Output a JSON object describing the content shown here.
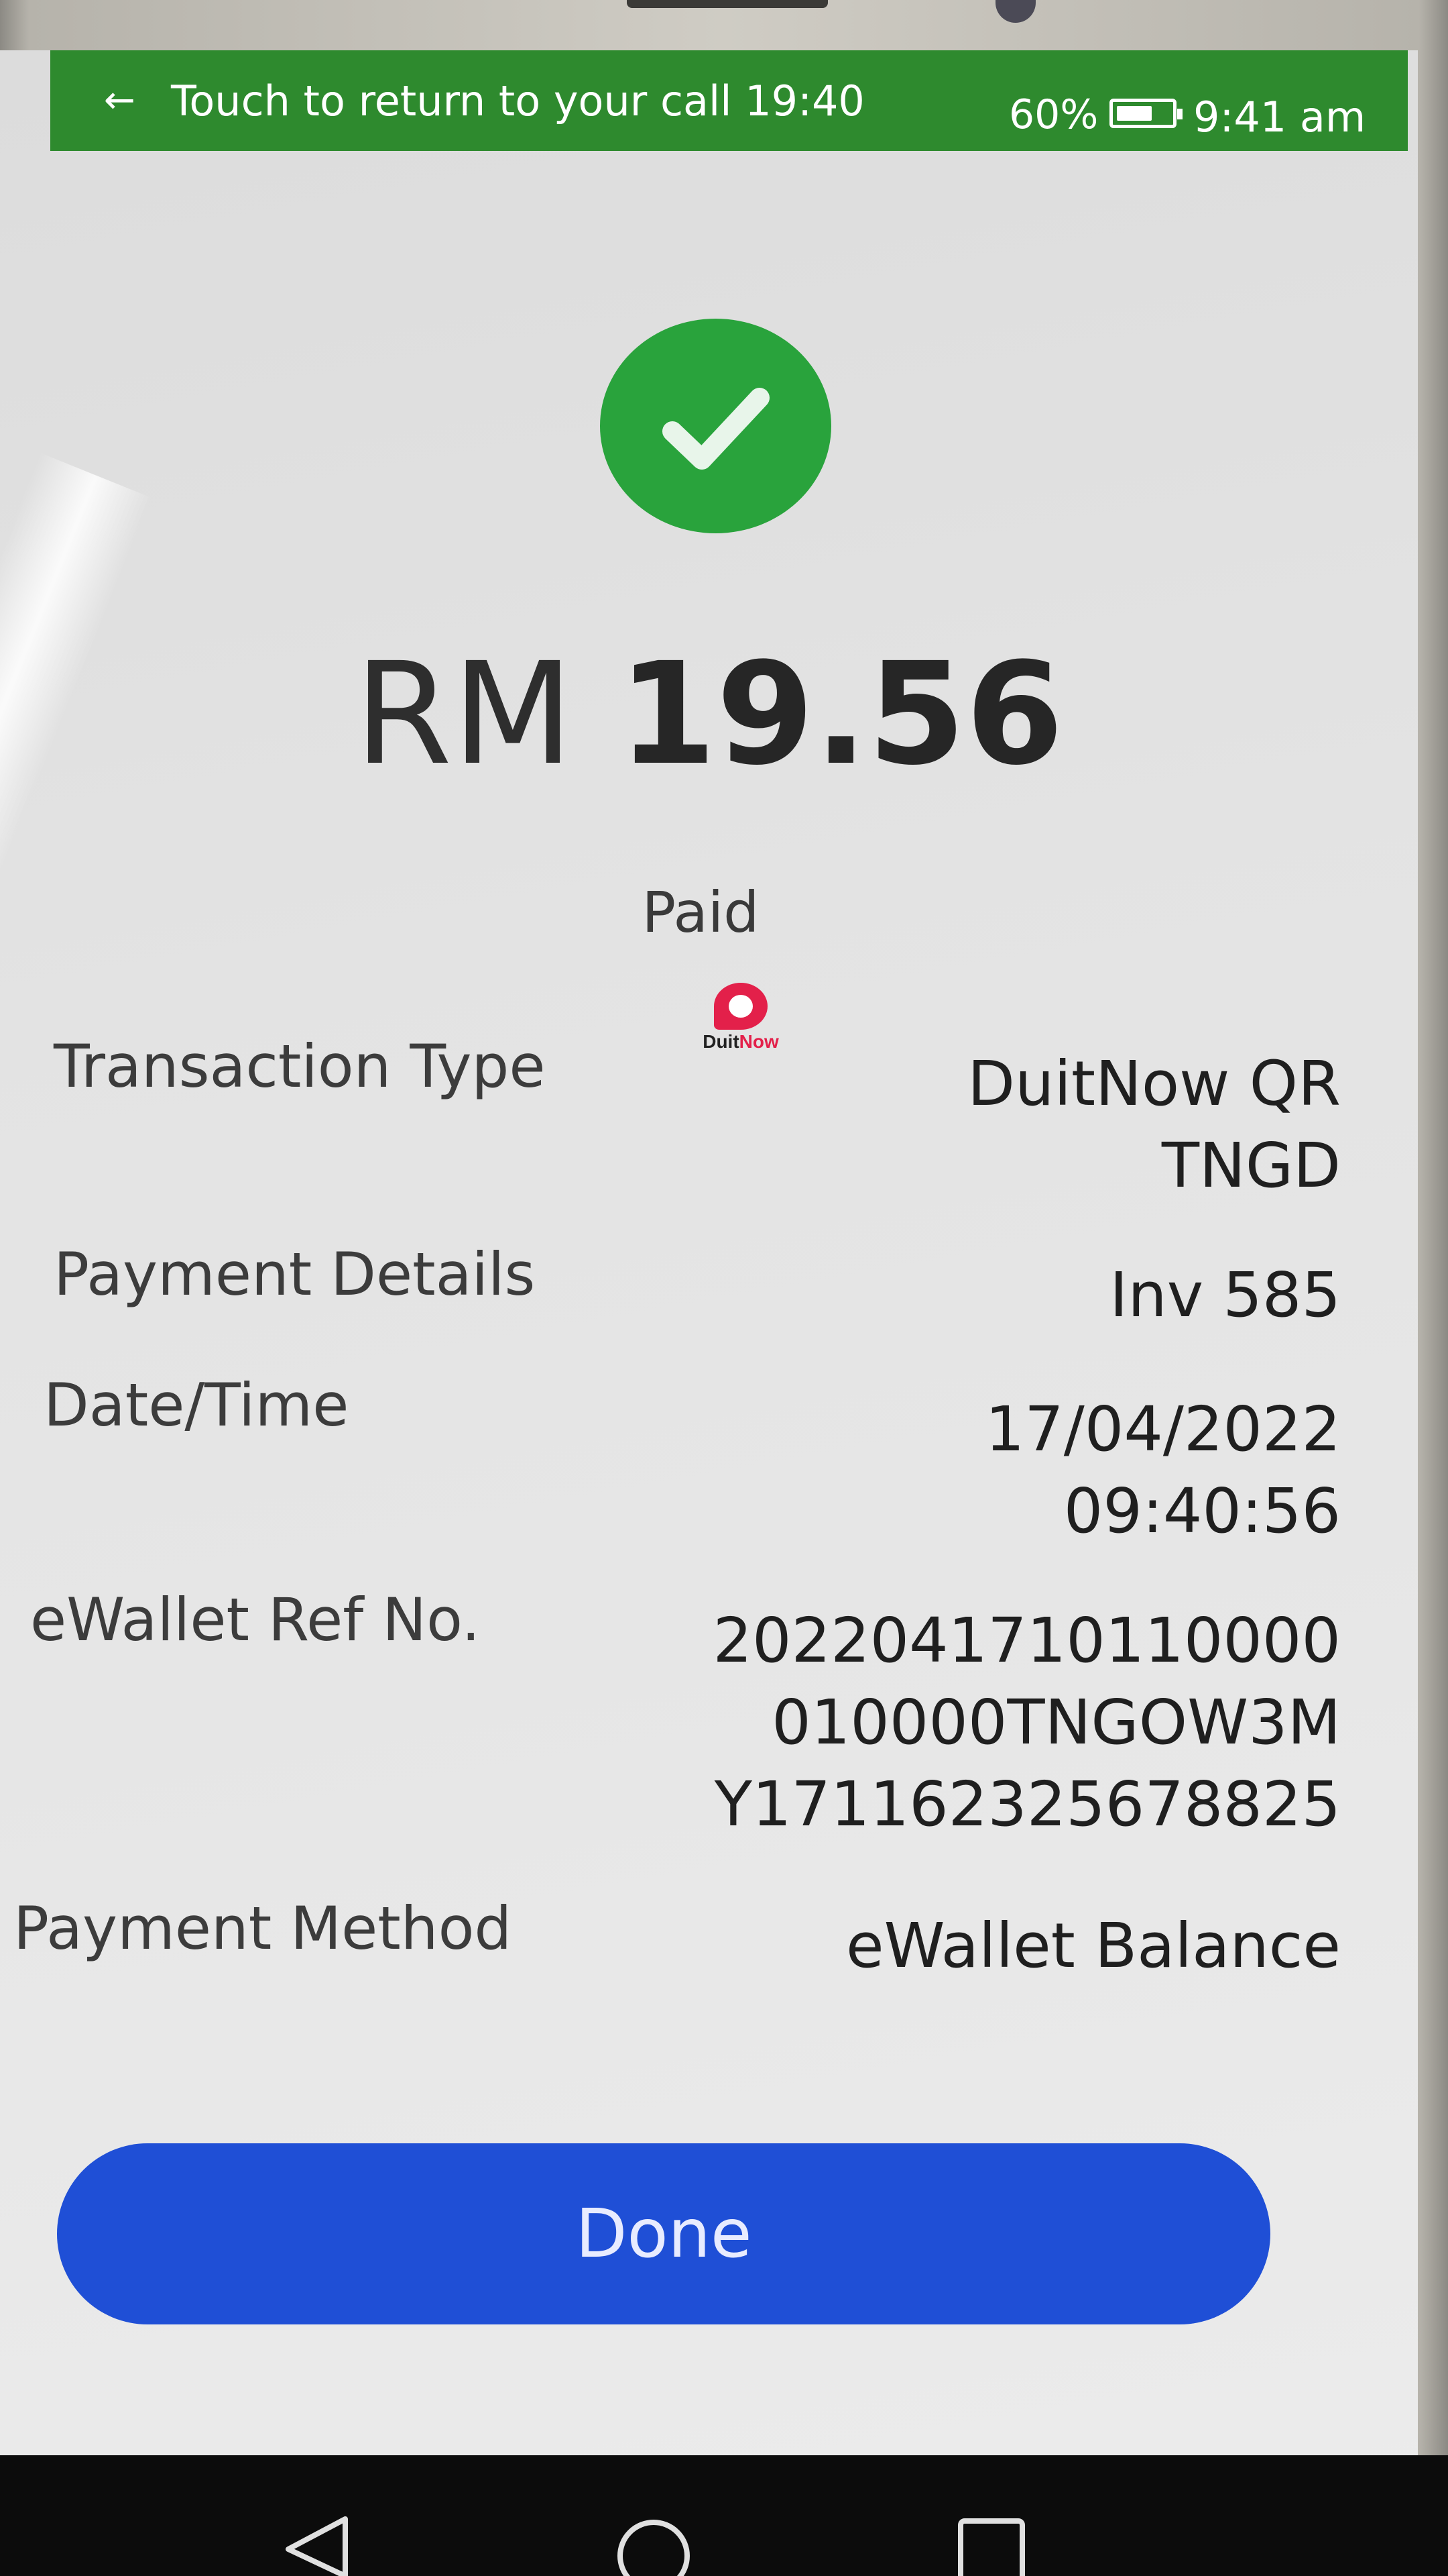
{
  "status_bar": {
    "call_text": "Touch to return to your call 19:40",
    "battery_percent": "60%",
    "clock": "9:41 am",
    "back_icon": "back-arrow-icon",
    "battery_icon": "battery-icon",
    "bar_color": "#2e8a2e"
  },
  "receipt": {
    "currency": "RM",
    "amount": "19.56",
    "status": "Paid",
    "success_color": "#29a33c",
    "rows": [
      {
        "label": "Transaction Type",
        "lines": [
          "DuitNow QR",
          "TNGD"
        ]
      },
      {
        "label": "Payment Details",
        "lines": [
          "Inv 585"
        ]
      },
      {
        "label": "Date/Time",
        "lines": [
          "17/04/2022",
          "09:40:56"
        ]
      },
      {
        "label": "eWallet Ref No.",
        "lines": [
          "2022041710110000",
          "010000TNGOW3M",
          "Y171162325678825"
        ]
      },
      {
        "label": "Payment Method",
        "lines": [
          "eWallet Balance"
        ]
      }
    ],
    "logo": {
      "part1": "Duit",
      "part2": "Now"
    }
  },
  "actions": {
    "done_label": "Done",
    "done_color": "#1f4fd6"
  },
  "navigation": {
    "back": "back-triangle-icon",
    "home": "home-circle-icon",
    "recents": "recents-square-icon"
  }
}
